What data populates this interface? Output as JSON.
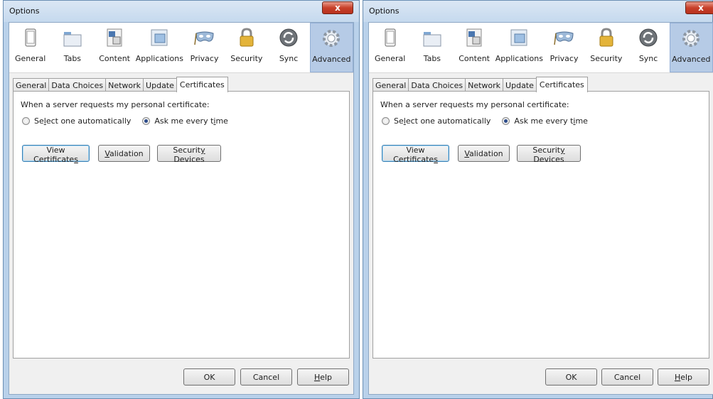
{
  "window": {
    "title": "Options",
    "close_glyph": "x"
  },
  "toolbar": {
    "panes": [
      {
        "label": "General",
        "icon": "general-icon"
      },
      {
        "label": "Tabs",
        "icon": "tabs-icon"
      },
      {
        "label": "Content",
        "icon": "content-icon"
      },
      {
        "label": "Applications",
        "icon": "applications-icon"
      },
      {
        "label": "Privacy",
        "icon": "privacy-mask-icon"
      },
      {
        "label": "Security",
        "icon": "padlock-icon"
      },
      {
        "label": "Sync",
        "icon": "sync-icon"
      },
      {
        "label": "Advanced",
        "icon": "gear-icon"
      }
    ],
    "selected": "Advanced"
  },
  "tabs": [
    "General",
    "Data Choices",
    "Network",
    "Update",
    "Certificates"
  ],
  "active_tab": "Certificates",
  "certificates": {
    "prompt": "When a server requests my personal certificate:",
    "radio_auto": {
      "pre": "Se",
      "accel": "l",
      "post": "ect one automatically",
      "checked": false
    },
    "radio_ask": {
      "pre": "Ask me every t",
      "accel": "i",
      "post": "me",
      "checked": true
    },
    "btn_view": {
      "pre": "View Certificate",
      "accel": "s",
      "post": ""
    },
    "btn_validation": {
      "pre": "",
      "accel": "V",
      "post": "alidation"
    },
    "btn_security": {
      "pre": "Securit",
      "accel": "y",
      "post": " Devices"
    }
  },
  "footer": {
    "ok": "OK",
    "cancel": "Cancel",
    "help": {
      "pre": "",
      "accel": "H",
      "post": "elp"
    }
  },
  "colors": {
    "window_frame": "#b9d1ea",
    "selected_pane": "#b6cbe6",
    "close_button": "#c8402a",
    "default_button_border": "#3c7fb1"
  }
}
